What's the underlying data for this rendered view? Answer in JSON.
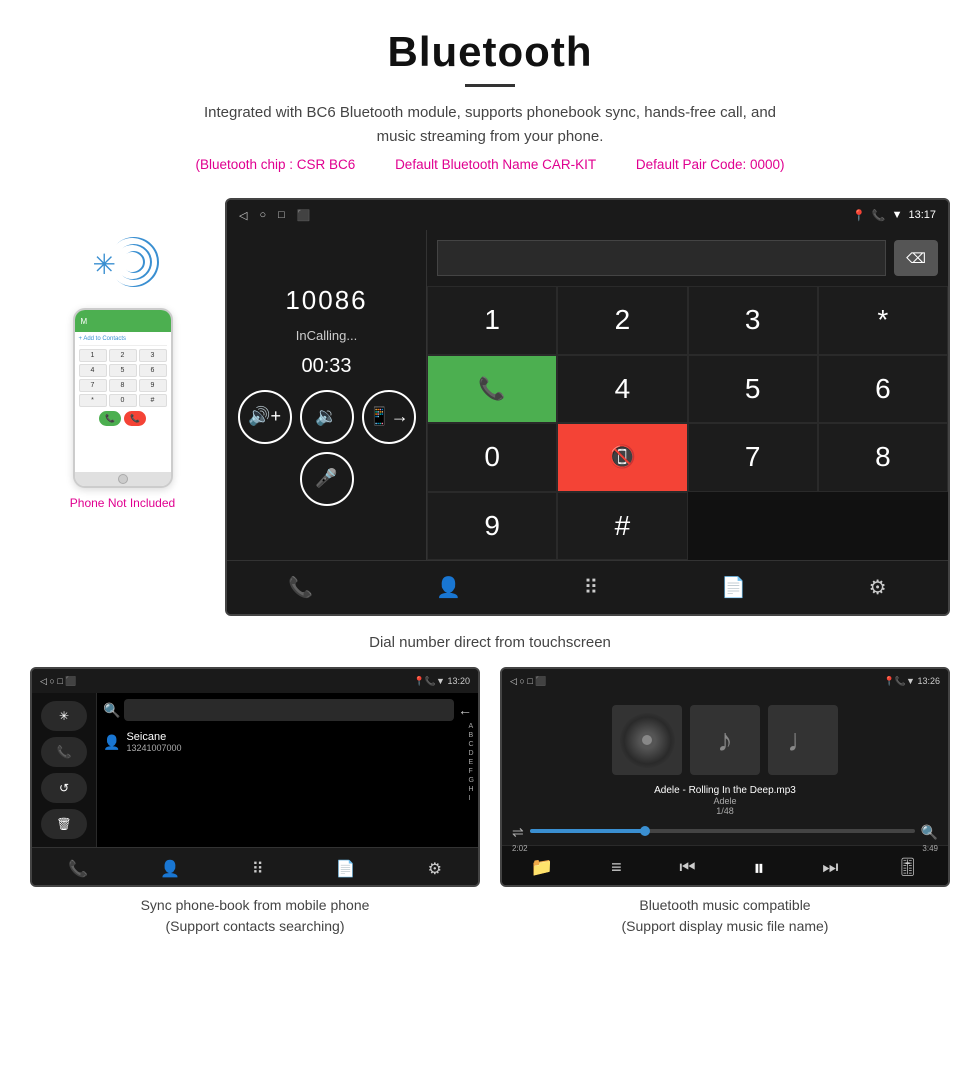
{
  "header": {
    "title": "Bluetooth",
    "description": "Integrated with BC6 Bluetooth module, supports phonebook sync, hands-free call, and music streaming from your phone.",
    "specs": [
      "(Bluetooth chip : CSR BC6",
      "Default Bluetooth Name CAR-KIT",
      "Default Pair Code: 0000)"
    ]
  },
  "main_screen": {
    "status_bar": {
      "back": "◁",
      "home": "○",
      "recent": "□",
      "screenshot": "⬛",
      "location": "♦",
      "phone": "📞",
      "wifi": "▼",
      "time": "13:17"
    },
    "dial": {
      "number": "10086",
      "status": "InCalling...",
      "timer": "00:33"
    },
    "keypad": {
      "keys": [
        "1",
        "2",
        "3",
        "*",
        "4",
        "5",
        "6",
        "0",
        "7",
        "8",
        "9",
        "#"
      ]
    },
    "caption": "Dial number direct from touchscreen"
  },
  "phone": {
    "not_included": "Phone Not Included",
    "add_contact": "+ Add to Contacts",
    "keys": [
      "1",
      "2",
      "3",
      "4",
      "5",
      "6",
      "7",
      "8",
      "9",
      "*",
      "0",
      "#"
    ]
  },
  "phonebook_screen": {
    "status_bar_right": "13:20",
    "contact_name": "Seicane",
    "contact_number": "13241007000",
    "alphabet": [
      "A",
      "B",
      "C",
      "D",
      "E",
      "F",
      "G",
      "H",
      "I"
    ],
    "caption": "Sync phone-book from mobile phone\n(Support contacts searching)"
  },
  "music_screen": {
    "status_bar_right": "13:26",
    "track": "Adele - Rolling In the Deep.mp3",
    "artist": "Adele",
    "count": "1/48",
    "current_time": "2:02",
    "total_time": "3:49",
    "caption": "Bluetooth music compatible\n(Support display music file name)"
  }
}
